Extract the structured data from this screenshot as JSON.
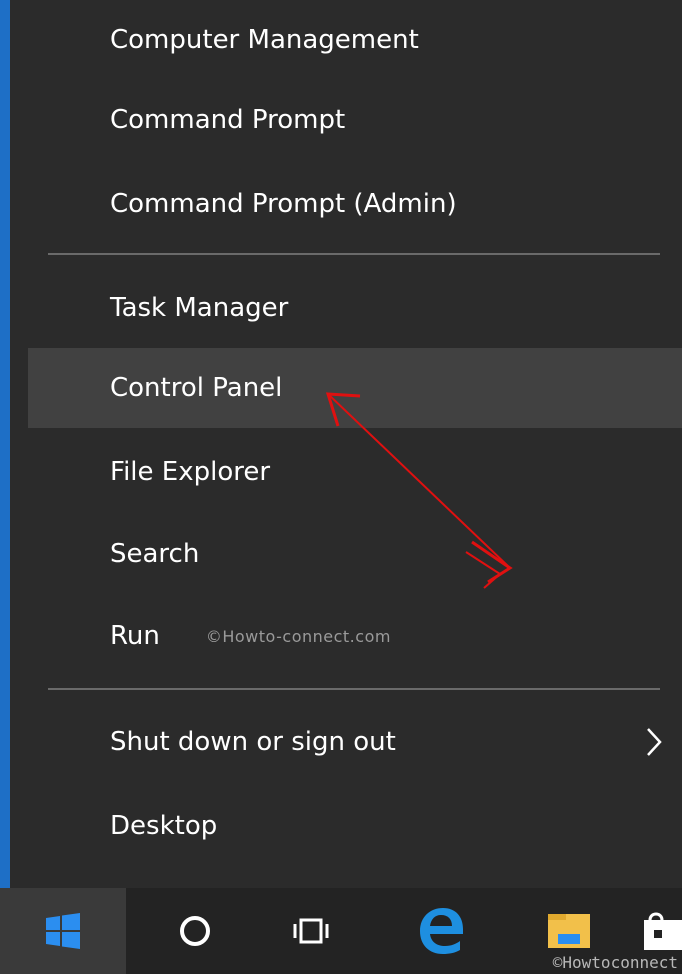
{
  "menu": {
    "items": [
      {
        "label": "Computer Management"
      },
      {
        "label": "Command Prompt"
      },
      {
        "label": "Command Prompt (Admin)"
      },
      {
        "label": "Task Manager"
      },
      {
        "label": "Control Panel"
      },
      {
        "label": "File Explorer"
      },
      {
        "label": "Search"
      },
      {
        "label": "Run"
      },
      {
        "label": "Shut down or sign out"
      },
      {
        "label": "Desktop"
      }
    ],
    "highlighted": "Control Panel",
    "inline_watermark": "©Howto-connect.com"
  },
  "taskbar": {
    "watermark": "©Howtoconnect",
    "icons": [
      "windows-start-icon",
      "cortana-circle-icon",
      "task-view-icon",
      "edge-browser-icon",
      "file-explorer-icon",
      "store-icon"
    ]
  },
  "colors": {
    "menu_bg": "#2b2b2b",
    "highlight_bg": "#414141",
    "text": "#ffffff",
    "accent_blue": "#1e6fc6",
    "annotation_red": "#e01010"
  }
}
